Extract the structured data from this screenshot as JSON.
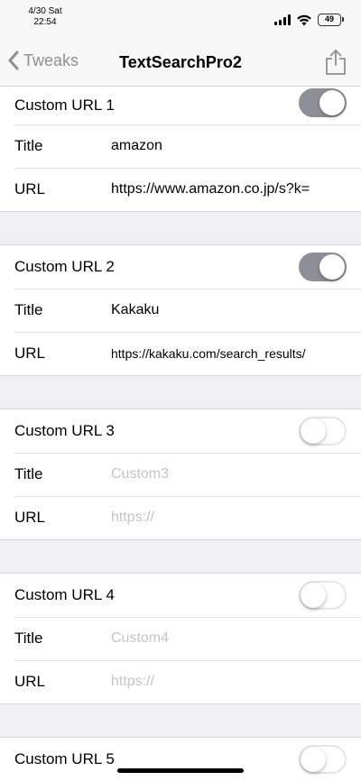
{
  "status_bar": {
    "date": "4/30 Sat",
    "time": "22:54",
    "battery": "49"
  },
  "nav": {
    "back_label": "Tweaks",
    "title": "TextSearchPro2"
  },
  "sections": [
    {
      "header": "Custom URL 1",
      "enabled": true,
      "title_label": "Title",
      "title_value": "amazon",
      "url_label": "URL",
      "url_value": "https://www.amazon.co.jp/s?k="
    },
    {
      "header": "Custom URL 2",
      "enabled": true,
      "title_label": "Title",
      "title_value": "Kakaku",
      "url_label": "URL",
      "url_value": "https://kakaku.com/search_results/"
    },
    {
      "header": "Custom URL 3",
      "enabled": false,
      "title_label": "Title",
      "title_placeholder": "Custom3",
      "url_label": "URL",
      "url_placeholder": "https://"
    },
    {
      "header": "Custom URL 4",
      "enabled": false,
      "title_label": "Title",
      "title_placeholder": "Custom4",
      "url_label": "URL",
      "url_placeholder": "https://"
    },
    {
      "header": "Custom URL 5",
      "enabled": false
    }
  ],
  "colors": {
    "toggle_on": "#8e8e96",
    "background": "#efeff4",
    "placeholder": "#c4c4c8"
  }
}
